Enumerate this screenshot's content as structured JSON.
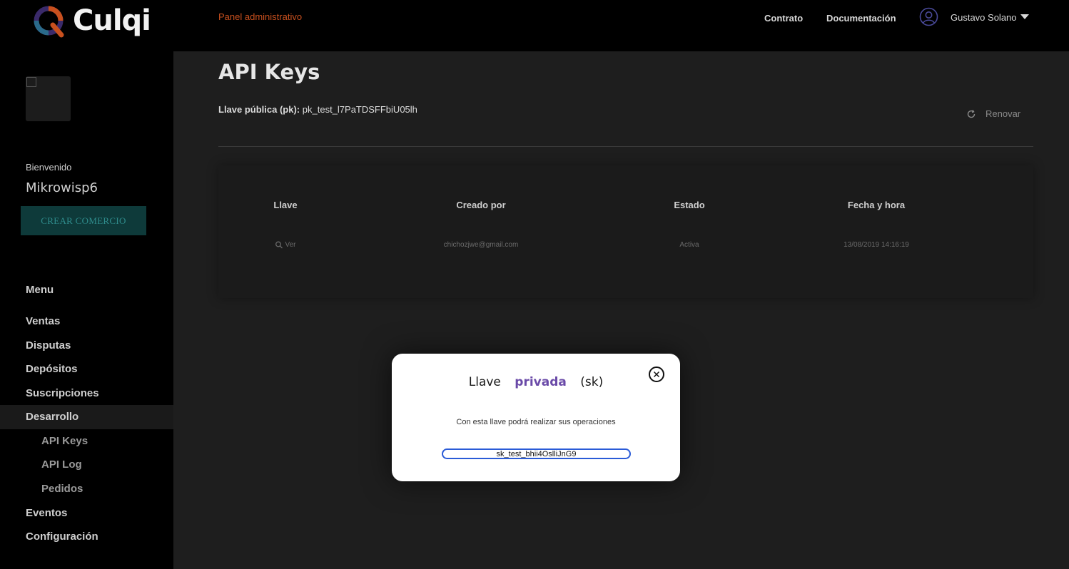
{
  "header": {
    "logo_text": "Culqi",
    "panel_label": "Panel administrativo",
    "links": [
      "Contrato",
      "Documentación"
    ],
    "user_name": "Gustavo Solano"
  },
  "sidebar": {
    "welcome": "Bienvenido",
    "company": "Mikrowisp6",
    "create_button": "CREAR COMERCIO",
    "menu_heading": "Menu",
    "items": [
      "Ventas",
      "Disputas",
      "Depósitos",
      "Suscripciones",
      "Desarrollo"
    ],
    "sub_items": [
      "API Keys",
      "API Log",
      "Pedidos"
    ],
    "items_after": [
      "Eventos",
      "Configuración"
    ],
    "active_item": "Desarrollo"
  },
  "main": {
    "title": "API Keys",
    "pk_label": "Llave pública (pk):",
    "pk_value": "pk_test_l7PaTDSFFbiU05lh",
    "renew_label": "Renovar",
    "table": {
      "headers": [
        "Llave",
        "Creado por",
        "Estado",
        "Fecha y hora"
      ],
      "rows": [
        {
          "key": "Ver",
          "created_by": "chichozjwe@gmail.com",
          "status": "Activa",
          "datetime": "13/08/2019 14:16:19"
        }
      ]
    }
  },
  "modal": {
    "title_1": "Llave",
    "title_2": "privada",
    "title_3": "(sk)",
    "description": "Con esta llave podrá realizar sus operaciones",
    "secret_key": "sk_test_bhii4OslliJnG9"
  },
  "colors": {
    "accent_orange": "#c8501e",
    "teal": "#0e3a3a",
    "purple": "#6a4aa8",
    "focus_blue": "#2a5bd7"
  },
  "icons": [
    "culqi-logo-icon",
    "user-circle-icon",
    "caret-down-icon",
    "refresh-icon",
    "search-icon",
    "close-icon"
  ]
}
